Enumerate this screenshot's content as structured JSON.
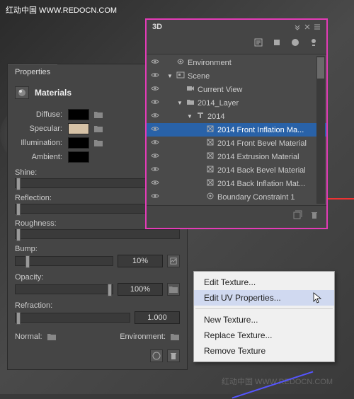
{
  "watermark": "红动中国 WWW.REDOCN.COM",
  "watermark2": "红动中国 WWW.REDOCN.COM",
  "properties": {
    "tab_label": "Properties",
    "section_title": "Materials",
    "diffuse_label": "Diffuse:",
    "specular_label": "Specular:",
    "illumination_label": "Illumination:",
    "ambient_label": "Ambient:",
    "shine_label": "Shine:",
    "reflection_label": "Reflection:",
    "roughness_label": "Roughness:",
    "bump_label": "Bump:",
    "bump_value": "10%",
    "opacity_label": "Opacity:",
    "opacity_value": "100%",
    "refraction_label": "Refraction:",
    "refraction_value": "1.000",
    "normal_label": "Normal:",
    "environment_label": "Environment:",
    "colors": {
      "diffuse": "#000000",
      "specular": "#d6c2a6",
      "illumination": "#000000",
      "ambient": "#000000",
      "normal": "#8a8aff"
    }
  },
  "panel_3d": {
    "title": "3D",
    "items": [
      {
        "label": "Environment",
        "indent": 0,
        "icon": "env",
        "collapsible": false,
        "selected": false
      },
      {
        "label": "Scene",
        "indent": 0,
        "icon": "scene",
        "collapsible": true,
        "expanded": true,
        "selected": false
      },
      {
        "label": "Current View",
        "indent": 1,
        "icon": "camera",
        "collapsible": false,
        "selected": false
      },
      {
        "label": "2014_Layer",
        "indent": 1,
        "icon": "folder",
        "collapsible": true,
        "expanded": true,
        "selected": false
      },
      {
        "label": "2014",
        "indent": 2,
        "icon": "text3d",
        "collapsible": true,
        "expanded": true,
        "selected": false
      },
      {
        "label": "2014 Front Inflation Ma...",
        "indent": 3,
        "icon": "material",
        "collapsible": false,
        "selected": true
      },
      {
        "label": "2014 Front Bevel Material",
        "indent": 3,
        "icon": "material",
        "collapsible": false,
        "selected": false
      },
      {
        "label": "2014 Extrusion Material",
        "indent": 3,
        "icon": "material",
        "collapsible": false,
        "selected": false
      },
      {
        "label": "2014 Back Bevel Material",
        "indent": 3,
        "icon": "material",
        "collapsible": false,
        "selected": false
      },
      {
        "label": "2014 Back Inflation Mat...",
        "indent": 3,
        "icon": "material",
        "collapsible": false,
        "selected": false
      },
      {
        "label": "Boundary Constraint 1",
        "indent": 3,
        "icon": "constraint",
        "collapsible": false,
        "selected": false
      }
    ]
  },
  "context_menu": {
    "items": [
      {
        "label": "Edit Texture...",
        "hover": false
      },
      {
        "label": "Edit UV Properties...",
        "hover": true
      },
      {
        "label": "New Texture...",
        "hover": false
      },
      {
        "label": "Replace Texture...",
        "hover": false
      },
      {
        "label": "Remove Texture",
        "hover": false
      }
    ]
  }
}
